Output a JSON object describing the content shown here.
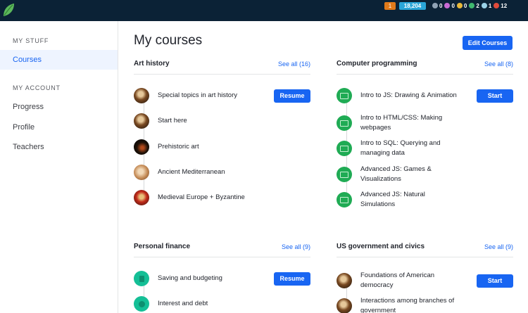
{
  "topbar": {
    "streak_count": "1",
    "energy_points": "18,204",
    "badges": [
      {
        "icon": "meteorite-badge-icon",
        "count": "0",
        "color": "#8fa2b5"
      },
      {
        "icon": "moon-badge-icon",
        "count": "0",
        "color": "#c86ad4"
      },
      {
        "icon": "earth-badge-icon",
        "count": "0",
        "color": "#e8b93a"
      },
      {
        "icon": "sun-badge-icon",
        "count": "2",
        "color": "#3fb86f"
      },
      {
        "icon": "black-hole-badge-icon",
        "count": "1",
        "color": "#9ad2e8"
      },
      {
        "icon": "challenge-patch-icon",
        "count": "12",
        "color": "#e04a3a"
      }
    ]
  },
  "sidebar": {
    "my_stuff_heading": "MY STUFF",
    "courses_label": "Courses",
    "my_account_heading": "MY ACCOUNT",
    "progress_label": "Progress",
    "profile_label": "Profile",
    "teachers_label": "Teachers"
  },
  "main": {
    "title": "My courses",
    "edit_courses_label": "Edit Courses"
  },
  "sections": {
    "art_history": {
      "title": "Art history",
      "see_all": "See all (16)",
      "items": [
        "Special topics in art history",
        "Start here",
        "Prehistoric art",
        "Ancient Mediterranean",
        "Medieval Europe + Byzantine"
      ],
      "button": "Resume"
    },
    "computer_programming": {
      "title": "Computer programming",
      "see_all": "See all (8)",
      "items": [
        "Intro to JS: Drawing & Animation",
        "Intro to HTML/CSS: Making webpages",
        "Intro to SQL: Querying and managing data",
        "Advanced JS: Games & Visualizations",
        "Advanced JS: Natural Simulations"
      ],
      "button": "Start"
    },
    "personal_finance": {
      "title": "Personal finance",
      "see_all": "See all (9)",
      "items": [
        "Saving and budgeting",
        "Interest and debt"
      ],
      "button": "Resume"
    },
    "us_government": {
      "title": "US government and civics",
      "see_all": "See all (9)",
      "items": [
        "Foundations of American democracy",
        "Interactions among branches of government"
      ],
      "button": "Start"
    }
  },
  "colors": {
    "accent": "#1865f2",
    "topbar": "#0b2236",
    "computing_green": "#1fab54",
    "finance_teal": "#14bf96"
  }
}
